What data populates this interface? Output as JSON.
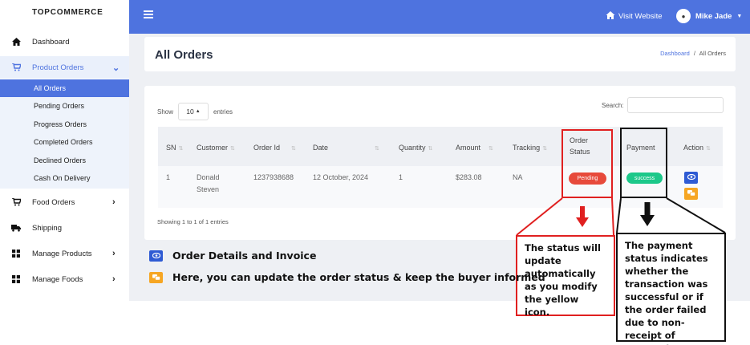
{
  "brand": "TOPCOMMERCE",
  "sidebar": {
    "items": [
      {
        "label": "Dashboard",
        "icon": "home-icon"
      },
      {
        "label": "Product Orders",
        "icon": "cart-icon"
      },
      {
        "label": "Food Orders",
        "icon": "cart-icon"
      },
      {
        "label": "Shipping",
        "icon": "truck-icon"
      },
      {
        "label": "Manage Products",
        "icon": "grid-icon"
      },
      {
        "label": "Manage Foods",
        "icon": "grid-icon"
      }
    ],
    "submenu": [
      "All Orders",
      "Pending Orders",
      "Progress Orders",
      "Completed Orders",
      "Declined Orders",
      "Cash On Delivery"
    ]
  },
  "topbar": {
    "visit_label": "Visit Website",
    "user_name": "Mike Jade"
  },
  "page": {
    "title": "All Orders",
    "breadcrumb_link": "Dashboard",
    "breadcrumb_sep": "/",
    "breadcrumb_current": "All Orders"
  },
  "table": {
    "show_label": "Show",
    "entries_value": "10",
    "entries_label": "entries",
    "search_label": "Search:",
    "headers": [
      "SN",
      "Customer",
      "Order Id",
      "Date",
      "Quantity",
      "Amount",
      "Tracking",
      "Order",
      "Status",
      "Payment",
      "Action"
    ],
    "row": {
      "sn": "1",
      "customer_first": "Donald",
      "customer_last": "Steven",
      "order_id": "1237938688",
      "date": "12 October, 2024",
      "quantity": "1",
      "amount": "$283.08",
      "tracking": "NA",
      "order_status": "Pending",
      "payment": "success"
    },
    "showing": "Showing 1 to 1 of 1 entries"
  },
  "legend": {
    "view": "Order Details and Invoice",
    "update": "Here, you can update the order status & keep the buyer informed"
  },
  "callouts": {
    "status": "The status will update automatically as you modify the yellow icon.",
    "payment": "The payment status indicates whether the transaction was successful or if the order failed due to non-receipt of payment."
  },
  "colors": {
    "primary": "#4e73df",
    "pending": "#e74a3b",
    "success": "#1cc88a",
    "edit": "#f6a623",
    "annotation_red": "#e02020"
  }
}
